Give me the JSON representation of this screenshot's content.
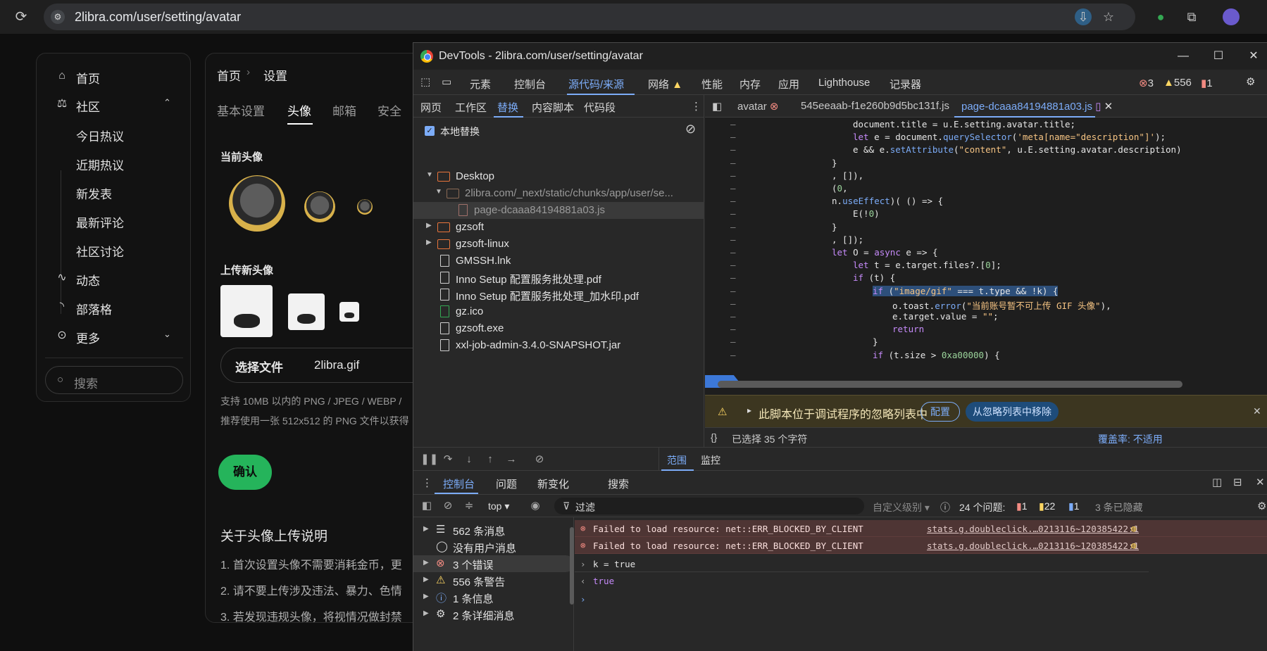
{
  "browser": {
    "url": "2libra.com/user/setting/avatar"
  },
  "site": {
    "nav": [
      {
        "label": "首页",
        "icon": "home-icon"
      },
      {
        "label": "社区",
        "icon": "scale-icon"
      }
    ],
    "community_sub": [
      "今日热议",
      "近期热议",
      "新发表",
      "最新评论",
      "社区讨论"
    ],
    "nav_bottom": [
      {
        "label": "动态",
        "icon": "activity-icon"
      },
      {
        "label": "部落格",
        "icon": "rss-icon"
      },
      {
        "label": "更多",
        "icon": "more-icon"
      }
    ],
    "search_placeholder": "搜索",
    "breadcrumb": [
      "首页",
      "设置"
    ],
    "tabs": [
      "基本设置",
      "头像",
      "邮箱",
      "安全"
    ],
    "current_avatar_heading": "当前头像",
    "upload_heading": "上传新头像",
    "choose_file_label": "选择文件",
    "chosen_file": "2libra.gif",
    "hint1": "支持 10MB 以内的 PNG / JPEG / WEBP /",
    "hint2": "推荐使用一张 512x512 的 PNG 文件以获得",
    "confirm_label": "确认",
    "about_heading": "关于头像上传说明",
    "about_items": [
      "1. 首次设置头像不需要消耗金币，更",
      "2. 请不要上传涉及违法、暴力、色情",
      "3. 若发现违规头像，将视情况做封禁"
    ]
  },
  "devtools": {
    "title": "DevTools - 2libra.com/user/setting/avatar",
    "tabs": [
      "元素",
      "控制台",
      "源代码/来源",
      "网络",
      "性能",
      "内存",
      "应用",
      "Lighthouse",
      "记录器"
    ],
    "counts": {
      "errors": "3",
      "warnings": "556",
      "info": "1"
    },
    "source_tabs": [
      "网页",
      "工作区",
      "替换",
      "内容脚本",
      "代码段"
    ],
    "local_override_label": "本地替换",
    "tree": [
      {
        "name": "Desktop",
        "type": "folder",
        "indent": 0,
        "open": true
      },
      {
        "name": "2libra.com/_next/static/chunks/app/user/se...",
        "type": "folder-dim",
        "indent": 1,
        "open": true
      },
      {
        "name": "page-dcaaa84194881a03.js",
        "type": "file-dim",
        "indent": 2
      },
      {
        "name": "gzsoft",
        "type": "folder",
        "indent": 0,
        "open": false
      },
      {
        "name": "gzsoft-linux",
        "type": "folder",
        "indent": 0,
        "open": false
      },
      {
        "name": "GMSSH.lnk",
        "type": "file",
        "indent": 0
      },
      {
        "name": "Inno Setup 配置服务批处理.pdf",
        "type": "file",
        "indent": 0
      },
      {
        "name": "Inno Setup 配置服务批处理_加水印.pdf",
        "type": "file",
        "indent": 0
      },
      {
        "name": "gz.ico",
        "type": "file-green",
        "indent": 0
      },
      {
        "name": "gzsoft.exe",
        "type": "file",
        "indent": 0
      },
      {
        "name": "xxl-job-admin-3.4.0-SNAPSHOT.jar",
        "type": "file",
        "indent": 0
      }
    ],
    "editor_tabs": [
      "avatar",
      "545eeaab-f1e260b9d5bc131f.js",
      "page-dcaaa84194881a03.js"
    ],
    "ignore_msg": "此脚本位于调试程序的忽略列表中",
    "configure_label": "配置",
    "remove_ignore_label": "从忽略列表中移除",
    "selected_text": "已选择 35 个字符",
    "coverage_text": "覆盖率: 不适用",
    "scope_tabs": [
      "范围",
      "监控"
    ],
    "drawer_tabs": [
      "控制台",
      "问题",
      "新变化",
      "搜索"
    ],
    "context": "top",
    "filter_placeholder": "过滤",
    "levels_label": "自定义级别",
    "issues_label": "24 个问题:",
    "issue_counts": {
      "errors": "1",
      "warnings": "22",
      "info": "1"
    },
    "hidden_label": "3 条已隐藏",
    "console_side": [
      {
        "label": "562 条消息",
        "icon": "list-icon"
      },
      {
        "label": "没有用户消息",
        "icon": "user-icon"
      },
      {
        "label": "3 个错误",
        "icon": "error-icon"
      },
      {
        "label": "556 条警告",
        "icon": "warning-icon"
      },
      {
        "label": "1 条信息",
        "icon": "info-icon"
      },
      {
        "label": "2 条详细消息",
        "icon": "gear-icon"
      }
    ],
    "console_log": {
      "error_msg": "Failed to load resource: net::ERR_BLOCKED_BY_CLIENT",
      "error_src": "stats.g.doubleclick.…0213116~120385422:1",
      "input": "k = true",
      "output": "true"
    }
  }
}
